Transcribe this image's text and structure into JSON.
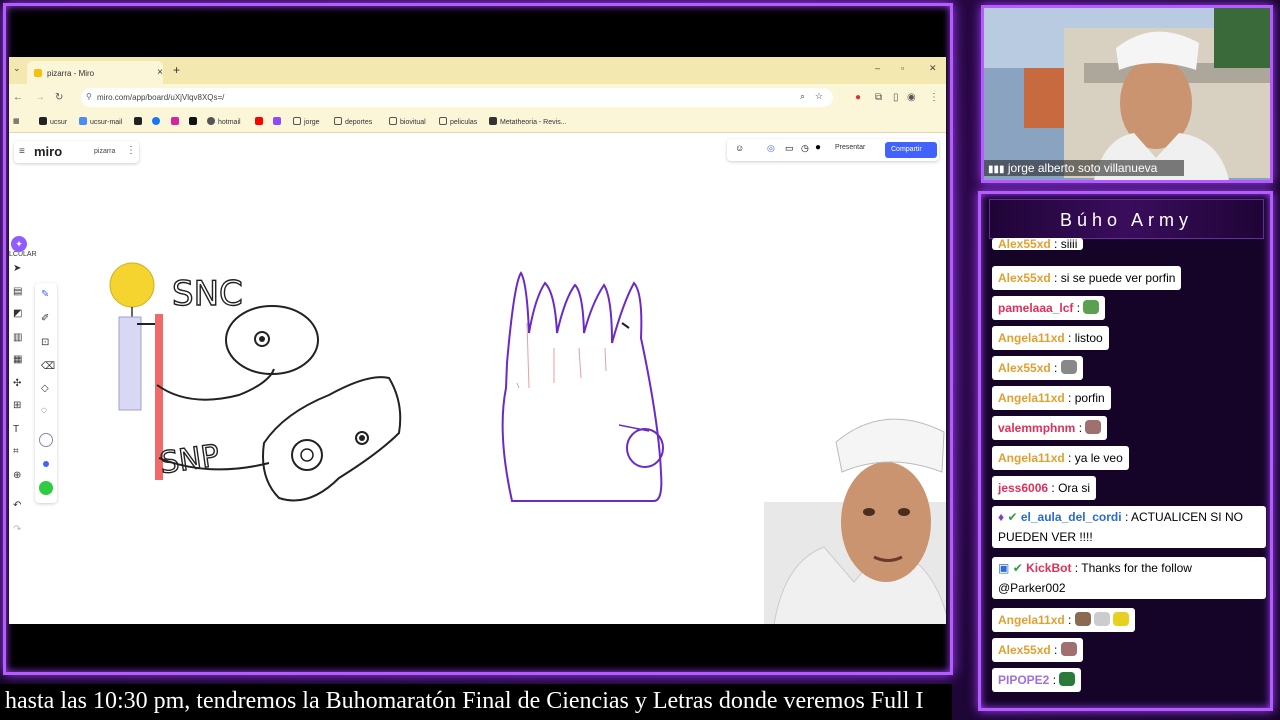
{
  "browser": {
    "tab_title": "pizarra - Miro",
    "url": "miro.com/app/board/uXjVlqv8XQs=/",
    "bookmarks": [
      "ucsur",
      "ucsur-mail",
      "hotmail",
      "jorge",
      "deportes",
      "biovitual",
      "peliculas",
      "Metatheoria - Revis..."
    ]
  },
  "miro": {
    "logo": "miro",
    "board_name": "pizarra",
    "present_label": "Presentar",
    "share_label": "Compartir",
    "calc_label": "LCULAR"
  },
  "drawing": {
    "label_snc": "SNC",
    "label_snp": "SNP"
  },
  "webcam": {
    "name": "jorge  alberto soto villanueva"
  },
  "chat": {
    "title": "Búho Army",
    "messages": [
      {
        "user": "Alex55xd",
        "text": ": siiii",
        "user_color": "#e0a030"
      },
      {
        "user": "Alex55xd",
        "text": ": si se puede ver porfin",
        "user_color": "#e0a030"
      },
      {
        "user": "pamelaaa_lcf",
        "text": ":",
        "user_color": "#e0305a"
      },
      {
        "user": "Angela11xd",
        "text": ": listoo",
        "user_color": "#e0a030"
      },
      {
        "user": "Alex55xd",
        "text": ":",
        "user_color": "#e0a030"
      },
      {
        "user": "Angela11xd",
        "text": ": porfin",
        "user_color": "#e0a030"
      },
      {
        "user": "valemmphnm",
        "text": ":",
        "user_color": "#e0305a"
      },
      {
        "user": "Angela11xd",
        "text": ": ya le veo",
        "user_color": "#e0a030"
      },
      {
        "user": "jess6006",
        "text": ": Ora si",
        "user_color": "#e0305a"
      },
      {
        "user": "el_aula_del_cordi",
        "text": ": ACTUALICEN SI NO PUEDEN VER !!!!",
        "user_color": "#2a6bd8"
      },
      {
        "user": "KickBot",
        "text": ": Thanks for the follow @Parker002",
        "user_color": "#e0305a"
      },
      {
        "user": "Angela11xd",
        "text": ":",
        "user_color": "#e0a030"
      },
      {
        "user": "Alex55xd",
        "text": ":",
        "user_color": "#e0a030"
      },
      {
        "user": "PIPOPE2",
        "text": ":",
        "user_color": "#a070e0"
      }
    ]
  },
  "ticker": "hasta las 10:30 pm, tendremos la Buhomaratón Final de Ciencias y Letras donde veremos Full I"
}
